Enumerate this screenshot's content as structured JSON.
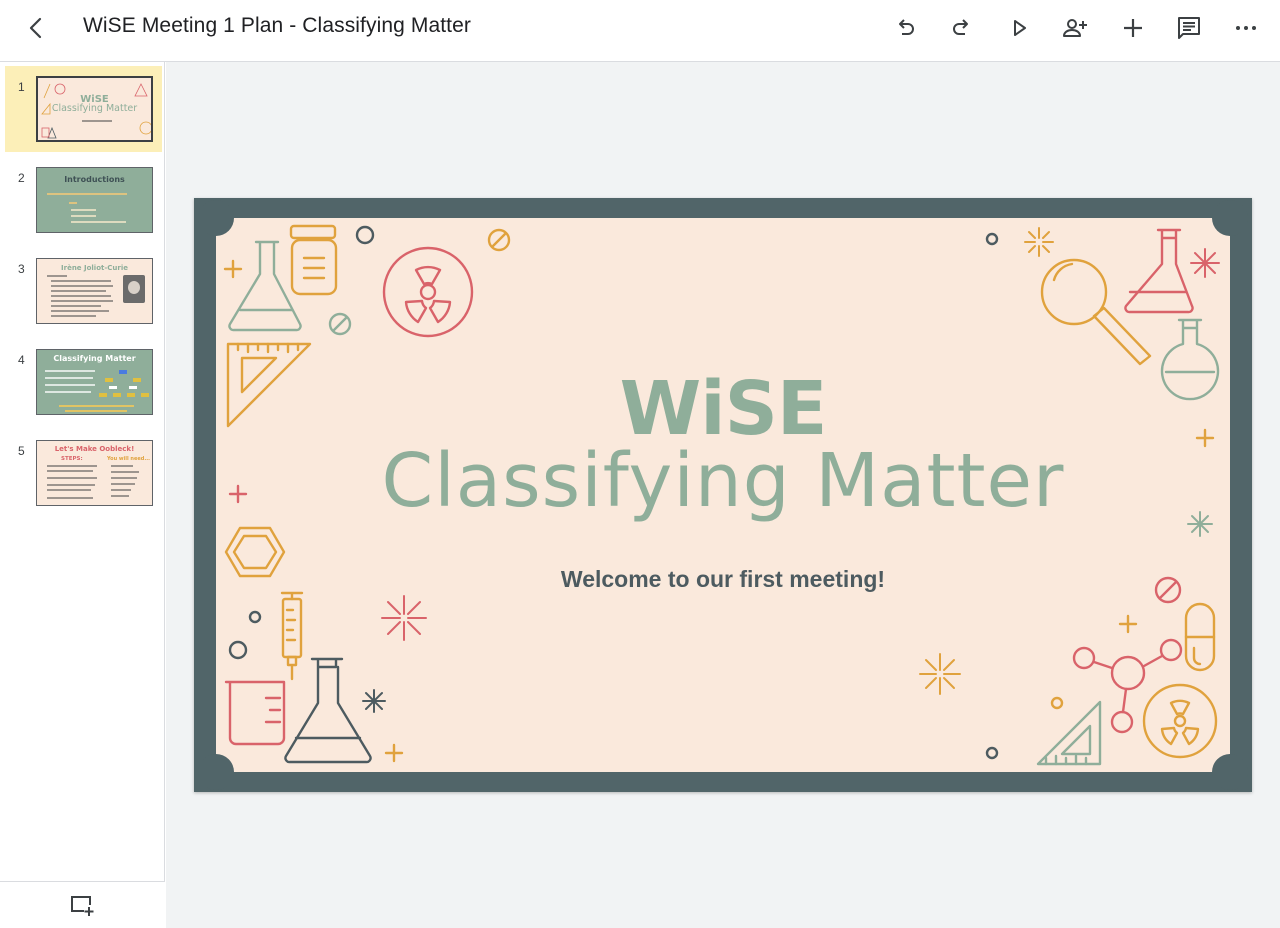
{
  "app": {
    "title": "WiSE Meeting 1 Plan - Classifying Matter"
  },
  "toolbar": {
    "back": "back-arrow-icon",
    "buttons": [
      "undo-icon",
      "redo-icon",
      "present-play-icon",
      "share-add-person-icon",
      "insert-plus-icon",
      "comments-icon",
      "more-options-icon"
    ]
  },
  "filmstrip": {
    "selected_index": 1,
    "slides": [
      {
        "number": "1",
        "brand": "WiSE",
        "title": "Classifying Matter",
        "subtitle": "Welcome to our first meeting!"
      },
      {
        "number": "2",
        "title": "Introductions"
      },
      {
        "number": "3",
        "title": "Irène Joliot-Curie"
      },
      {
        "number": "4",
        "title": "Classifying Matter"
      },
      {
        "number": "5",
        "title": "Let's Make Oobleck!",
        "col1": "STEPS:",
        "col2": "You will need..."
      }
    ],
    "new_slide_icon": "new-slide-icon"
  },
  "slide": {
    "brand": "WiSE",
    "title": "Classifying Matter",
    "subtitle": "Welcome to our first meeting!"
  },
  "colors": {
    "frame": "#516569",
    "background": "#fae9dc",
    "sage": "#8fae9a",
    "coral": "#d9636a",
    "gold": "#e0a23d",
    "slate": "#4d5b60",
    "selected_thumb": "#fcefb8"
  }
}
